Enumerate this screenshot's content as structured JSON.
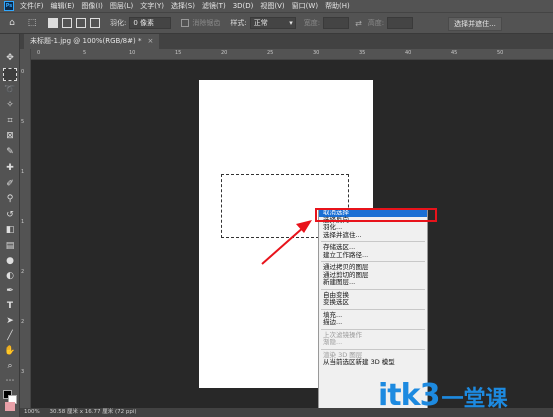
{
  "menubar": {
    "app_icon": "Ps",
    "items": [
      "文件(F)",
      "编辑(E)",
      "图像(I)",
      "图层(L)",
      "文字(Y)",
      "选择(S)",
      "滤镜(T)",
      "3D(D)",
      "视图(V)",
      "窗口(W)",
      "帮助(H)"
    ]
  },
  "options": {
    "feather_label": "羽化:",
    "feather_value": "0 像素",
    "antialias_label": "消除锯齿",
    "style_label": "样式:",
    "style_value": "正常",
    "width_label": "宽度:",
    "height_label": "高度:",
    "select_mask_button": "选择并遮住..."
  },
  "tab": {
    "title": "未标题-1.jpg @ 100%(RGB/8#) *",
    "close": "×"
  },
  "ruler": {
    "top_ticks": [
      "0",
      "5",
      "10",
      "15",
      "20",
      "25",
      "30",
      "35",
      "40",
      "45",
      "50"
    ],
    "left_ticks": [
      "0",
      "5",
      "1",
      "1",
      "2",
      "2",
      "3"
    ]
  },
  "context_menu": {
    "items": [
      {
        "label": "取消选择",
        "state": "active"
      },
      {
        "label": "选择反向",
        "state": "normal"
      },
      {
        "label": "羽化...",
        "state": "normal"
      },
      {
        "label": "选择并遮住...",
        "state": "normal"
      },
      {
        "label": "-"
      },
      {
        "label": "存储选区...",
        "state": "normal"
      },
      {
        "label": "建立工作路径...",
        "state": "normal"
      },
      {
        "label": "-"
      },
      {
        "label": "通过拷贝的图层",
        "state": "normal"
      },
      {
        "label": "通过剪切的图层",
        "state": "normal"
      },
      {
        "label": "新建图层...",
        "state": "normal"
      },
      {
        "label": "-"
      },
      {
        "label": "自由变换",
        "state": "normal"
      },
      {
        "label": "变换选区",
        "state": "normal"
      },
      {
        "label": "-"
      },
      {
        "label": "填充...",
        "state": "normal"
      },
      {
        "label": "描边...",
        "state": "normal"
      },
      {
        "label": "-"
      },
      {
        "label": "上次滤镜操作",
        "state": "disabled"
      },
      {
        "label": "渐隐...",
        "state": "disabled"
      },
      {
        "label": "-"
      },
      {
        "label": "渲染 3D 图层",
        "state": "disabled"
      },
      {
        "label": "从当前选区新建 3D 模型",
        "state": "normal"
      }
    ]
  },
  "status": {
    "zoom": "100%",
    "doc_size": "30.58 厘米 x 16.77 厘米 (72 ppi)"
  },
  "watermark": {
    "latin": "itk3",
    "cjk": "一堂课"
  },
  "colors": {
    "accent": "#1a6fd4",
    "annotation": "#e8131b",
    "watermark": "#1d8ae0"
  }
}
